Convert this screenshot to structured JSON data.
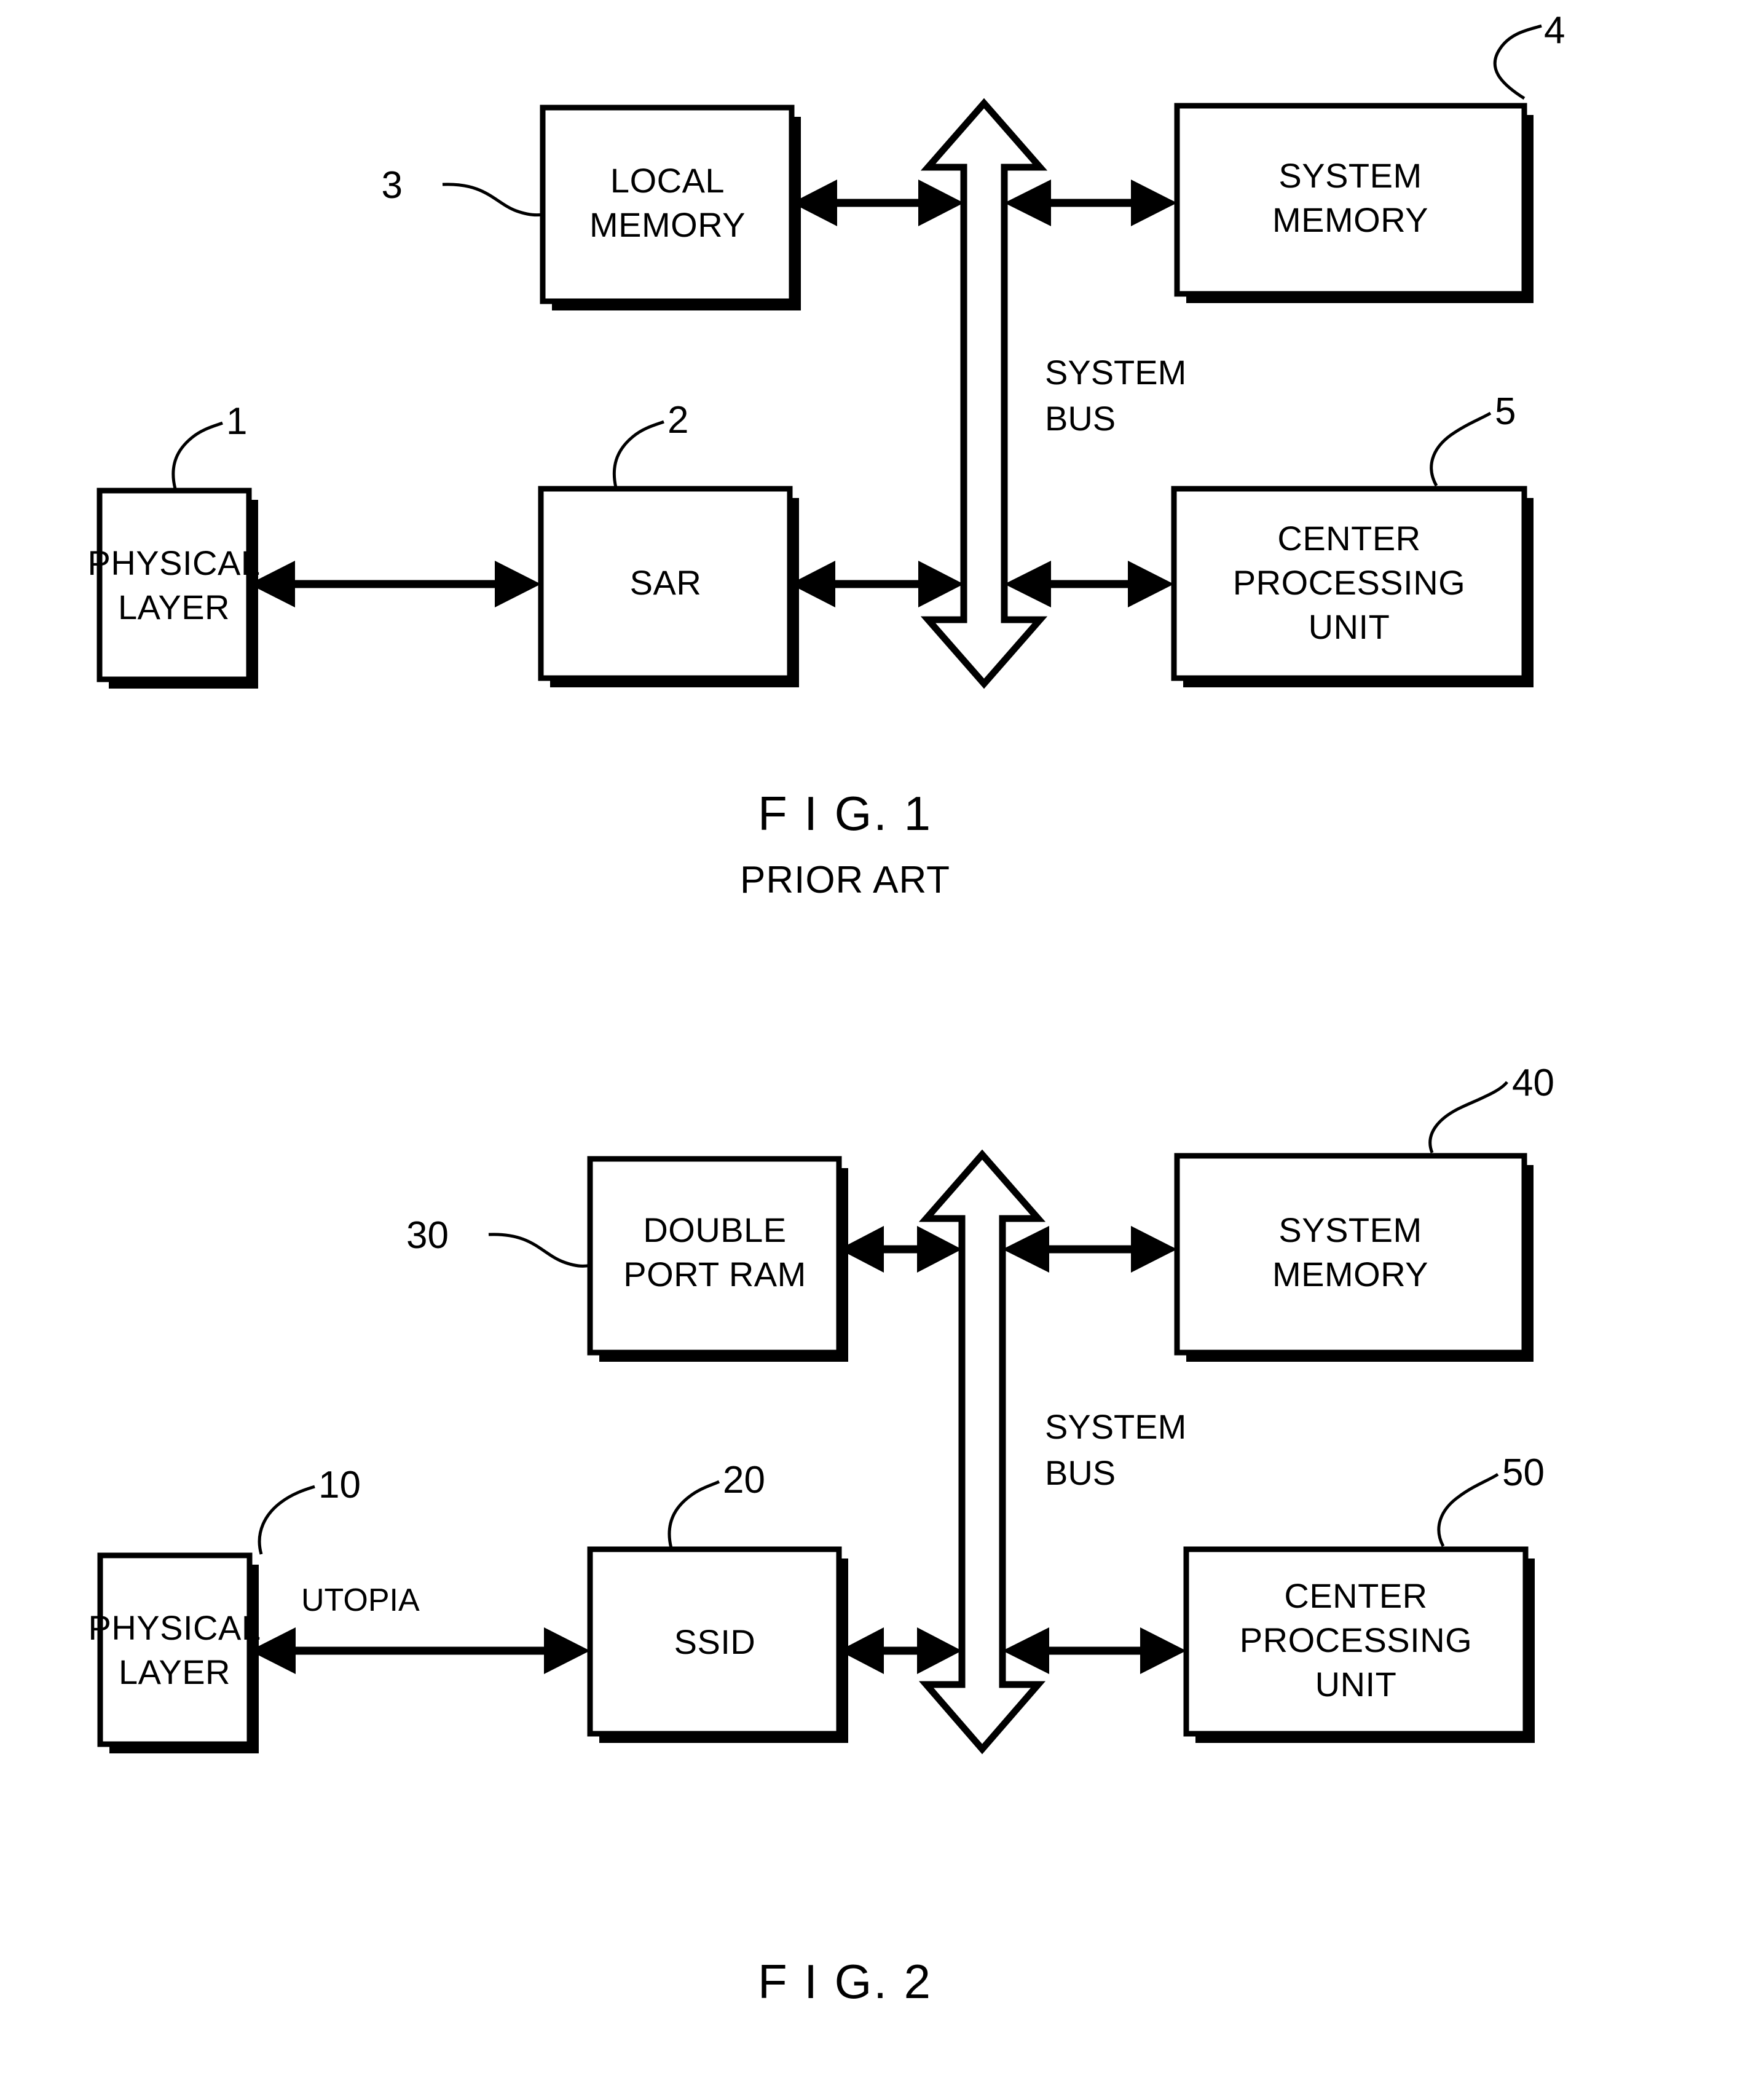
{
  "figures": [
    {
      "id": "fig1",
      "title": "F I G. 1",
      "subtitle": "PRIOR ART",
      "bus_label_line1": "SYSTEM",
      "bus_label_line2": "BUS",
      "boxes": [
        {
          "name": "local-memory",
          "lines": [
            "LOCAL",
            "MEMORY"
          ],
          "ref": "3"
        },
        {
          "name": "system-memory",
          "lines": [
            "SYSTEM",
            "MEMORY"
          ],
          "ref": "4"
        },
        {
          "name": "physical-layer",
          "lines": [
            "PHYSICAL",
            "LAYER"
          ],
          "ref": "1"
        },
        {
          "name": "sar",
          "lines": [
            "SAR"
          ],
          "ref": "2"
        },
        {
          "name": "center-processing-unit",
          "lines": [
            "CENTER",
            "PROCESSING",
            "UNIT"
          ],
          "ref": "5"
        }
      ]
    },
    {
      "id": "fig2",
      "title": "F I G. 2",
      "subtitle": "",
      "bus_label_line1": "SYSTEM",
      "bus_label_line2": "BUS",
      "interface_label": "UTOPIA",
      "boxes": [
        {
          "name": "double-port-ram",
          "lines": [
            "DOUBLE",
            "PORT RAM"
          ],
          "ref": "30"
        },
        {
          "name": "system-memory",
          "lines": [
            "SYSTEM",
            "MEMORY"
          ],
          "ref": "40"
        },
        {
          "name": "physical-layer",
          "lines": [
            "PHYSICAL",
            "LAYER"
          ],
          "ref": "10"
        },
        {
          "name": "ssid",
          "lines": [
            "SSID"
          ],
          "ref": "20"
        },
        {
          "name": "center-processing-unit",
          "lines": [
            "CENTER",
            "PROCESSING",
            "UNIT"
          ],
          "ref": "50"
        }
      ]
    }
  ],
  "colors": {
    "ink": "#000000",
    "paper": "#ffffff"
  }
}
